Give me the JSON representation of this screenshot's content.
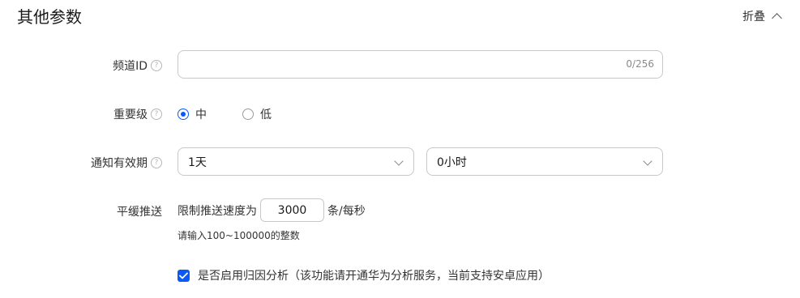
{
  "section": {
    "title": "其他参数",
    "collapse_label": "折叠"
  },
  "fields": {
    "channel_id": {
      "label": "频道ID",
      "value": "",
      "counter": "0/256"
    },
    "importance": {
      "label": "重要级",
      "options": [
        {
          "label": "中",
          "checked": true
        },
        {
          "label": "低",
          "checked": false
        }
      ]
    },
    "validity": {
      "label": "通知有效期",
      "day_value": "1天",
      "hour_value": "0小时"
    },
    "smooth_push": {
      "label": "平缓推送",
      "prefix": "限制推送速度为",
      "rate_value": "3000",
      "suffix": "条/每秒",
      "hint": "请输入100~100000的整数"
    },
    "attribution": {
      "checked": true,
      "label": "是否启用归因分析（该功能请开通华为分析服务，当前支持安卓应用）"
    }
  },
  "colors": {
    "accent": "#0a59f7",
    "border": "#c8c8c8",
    "muted": "#8a8a8a"
  }
}
